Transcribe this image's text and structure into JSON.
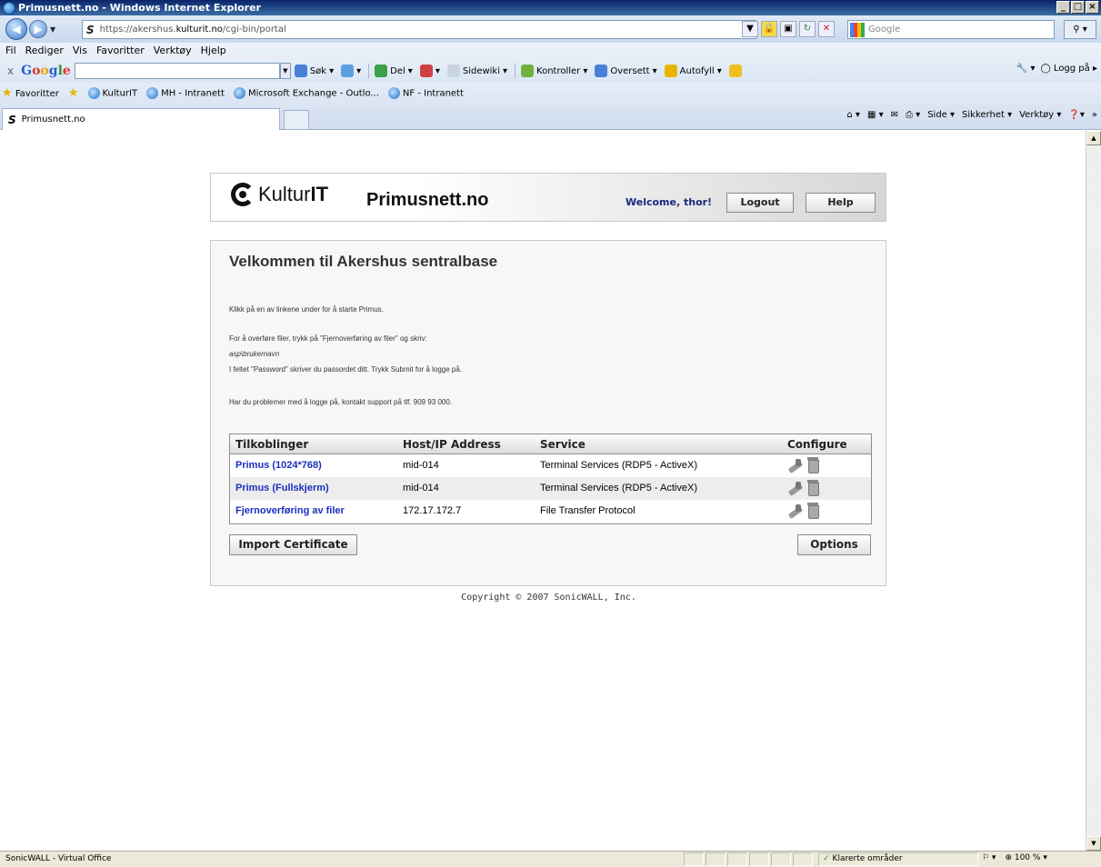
{
  "window": {
    "title": "Primusnett.no - Windows Internet Explorer",
    "controls": [
      "_",
      "□",
      "×"
    ]
  },
  "addressbar": {
    "url_prefix": "https://akershus.",
    "url_host": "kulturit.no",
    "url_path": "/cgi-bin/portal",
    "search_placeholder": "Google"
  },
  "menu": {
    "items": [
      "Fil",
      "Rediger",
      "Vis",
      "Favoritter",
      "Verktøy",
      "Hjelp"
    ]
  },
  "google_toolbar": {
    "close": "x",
    "logo": [
      "G",
      "o",
      "o",
      "g",
      "l",
      "e"
    ],
    "tools": [
      "Søk",
      "Del",
      "Sidewiki",
      "Kontroller",
      "Oversett",
      "Autofyll"
    ],
    "right": [
      "Logg på"
    ]
  },
  "favorites": {
    "label": "Favoritter",
    "links": [
      "KulturIT",
      "MH - Intranett",
      "Microsoft Exchange - Outlo...",
      "NF - Intranett"
    ]
  },
  "tab": {
    "title": "Primusnett.no"
  },
  "commandbar": {
    "items": [
      "Side",
      "Sikkerhet",
      "Verktøy"
    ]
  },
  "header": {
    "logo_light": "Kultur",
    "logo_bold": "IT",
    "brand": "Primusnett.no",
    "welcome": "Welcome, thor!",
    "logout": "Logout",
    "help": "Help"
  },
  "main": {
    "heading": "Velkommen til Akershus sentralbase",
    "line1": "Klikk på en av linkene under for å starte Primus.",
    "line2": "For å overføre filer, trykk på \"Fjernoverføring av filer\" og skriv:",
    "line3": "asp\\brukernavn",
    "line4": "I feltet \"Password\" skriver du passordet ditt. Trykk Submit for å logge på.",
    "line5": "Har du problemer med å logge på, kontakt support på tlf. 909 93 000."
  },
  "table": {
    "headers": [
      "Tilkoblinger",
      "Host/IP Address",
      "Service",
      "Configure"
    ],
    "rows": [
      {
        "name": "Primus (1024*768)",
        "host": "mid-014",
        "service": "Terminal Services (RDP5 - ActiveX)"
      },
      {
        "name": "Primus (Fullskjerm)",
        "host": "mid-014",
        "service": "Terminal Services (RDP5 - ActiveX)"
      },
      {
        "name": "Fjernoverføring av filer",
        "host": "172.17.172.7",
        "service": "File Transfer Protocol"
      }
    ]
  },
  "buttons": {
    "import": "Import Certificate",
    "options": "Options"
  },
  "footer": {
    "copyright": "Copyright © 2007 SonicWALL, Inc."
  },
  "statusbar": {
    "text": "SonicWALL - Virtual Office",
    "zone": "Klarerte områder",
    "zoom": "100 %"
  },
  "colors": {
    "link": "#1a2ec0",
    "welcome": "#1a2a80",
    "titlebar": "#0a246a"
  }
}
